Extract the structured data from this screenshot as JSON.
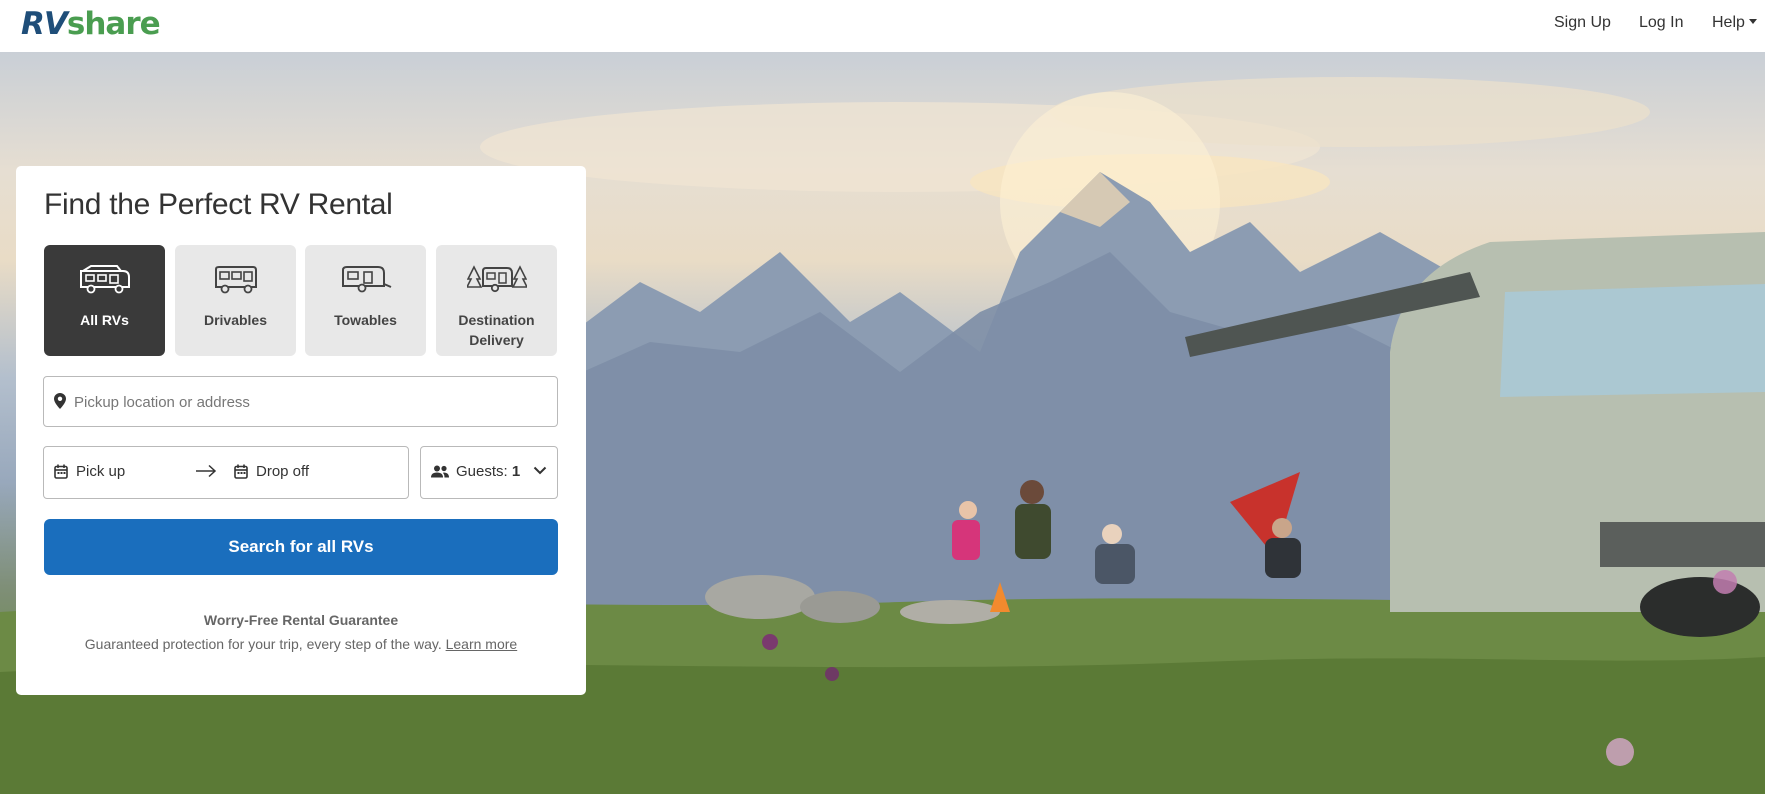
{
  "header": {
    "logo_rv": "RV",
    "logo_share": "share",
    "signup_label": "Sign Up",
    "login_label": "Log In",
    "help_label": "Help"
  },
  "search_card": {
    "title": "Find the Perfect RV Rental",
    "tiles": [
      {
        "label": "All RVs",
        "icon": "motorhome-icon",
        "selected": true
      },
      {
        "label": "Drivables",
        "icon": "drivable-rv-icon",
        "selected": false
      },
      {
        "label": "Towables",
        "icon": "trailer-icon",
        "selected": false
      },
      {
        "label": "Destination Delivery",
        "icon": "trailer-trees-icon",
        "selected": false
      }
    ],
    "location_placeholder": "Pickup location or address",
    "pickup_label": "Pick up",
    "dropoff_label": "Drop off",
    "guests_label": "Guests:",
    "guests_value": "1",
    "search_button": "Search for all RVs",
    "guarantee_title": "Worry-Free Rental Guarantee",
    "guarantee_text": "Guaranteed protection for your trip, every step of the way.",
    "learn_more": "Learn more"
  },
  "colors": {
    "primary_button": "#1a6ebd",
    "selected_tile": "#3a3a3a",
    "logo_rv": "#1f4e79",
    "logo_share": "#4a9d50"
  }
}
